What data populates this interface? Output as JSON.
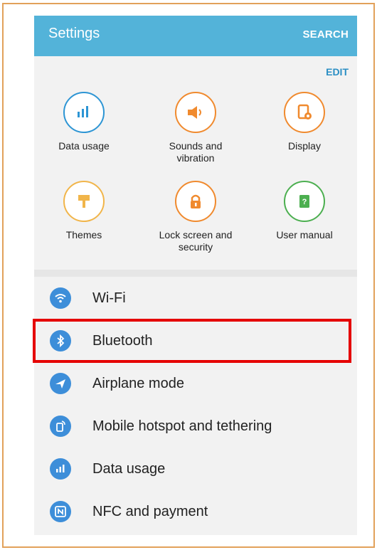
{
  "appbar": {
    "title": "Settings",
    "search_label": "SEARCH"
  },
  "quick": {
    "edit_label": "EDIT",
    "tiles": [
      {
        "label": "Data usage",
        "icon": "data-usage-icon",
        "color": "#2d95d4"
      },
      {
        "label": "Sounds and\nvibration",
        "icon": "volume-icon",
        "color": "#f08a2e"
      },
      {
        "label": "Display",
        "icon": "display-icon",
        "color": "#f08a2e"
      },
      {
        "label": "Themes",
        "icon": "brush-icon",
        "color": "#f1b54a"
      },
      {
        "label": "Lock screen and\nsecurity",
        "icon": "lock-icon",
        "color": "#f08a2e"
      },
      {
        "label": "User manual",
        "icon": "book-icon",
        "color": "#4caf50"
      }
    ]
  },
  "list": {
    "items": [
      {
        "label": "Wi-Fi",
        "icon": "wifi-icon"
      },
      {
        "label": "Bluetooth",
        "icon": "bluetooth-icon"
      },
      {
        "label": "Airplane mode",
        "icon": "airplane-icon"
      },
      {
        "label": "Mobile hotspot and tethering",
        "icon": "hotspot-icon"
      },
      {
        "label": "Data usage",
        "icon": "data-usage-icon"
      },
      {
        "label": "NFC and payment",
        "icon": "nfc-icon"
      }
    ]
  },
  "colors": {
    "appbar": "#53b3d9",
    "list_icon": "#3d8ed9",
    "highlight": "#e50000",
    "frame": "#e2a15a"
  }
}
